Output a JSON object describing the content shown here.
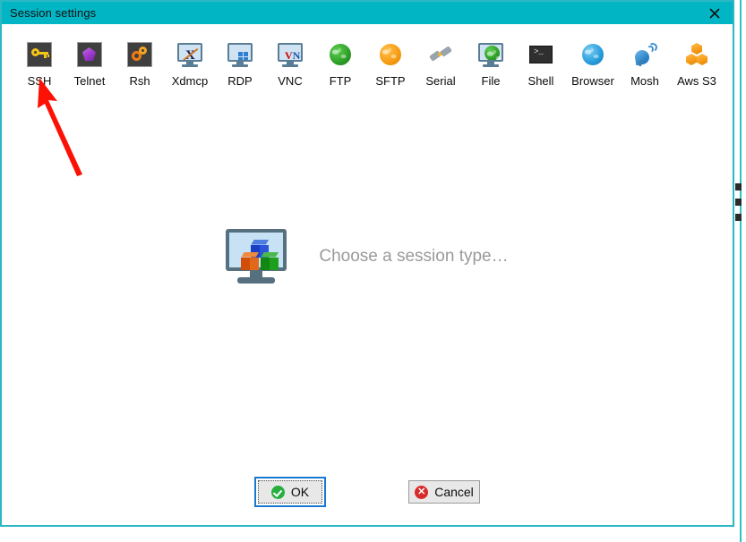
{
  "window": {
    "title": "Session settings",
    "close_icon": "close-icon",
    "title_bar_color": "#01b5c4",
    "border_color": "#2bb7c4"
  },
  "toolbar": {
    "items": [
      {
        "label": "SSH",
        "icon": "key-icon"
      },
      {
        "label": "Telnet",
        "icon": "gem-icon"
      },
      {
        "label": "Rsh",
        "icon": "gears-icon"
      },
      {
        "label": "Xdmcp",
        "icon": "x-monitor-icon"
      },
      {
        "label": "RDP",
        "icon": "windows-monitor-icon"
      },
      {
        "label": "VNC",
        "icon": "vnc-monitor-icon"
      },
      {
        "label": "FTP",
        "icon": "green-globe-icon"
      },
      {
        "label": "SFTP",
        "icon": "orange-globe-icon"
      },
      {
        "label": "Serial",
        "icon": "plug-icon"
      },
      {
        "label": "File",
        "icon": "globe-monitor-icon"
      },
      {
        "label": "Shell",
        "icon": "terminal-icon"
      },
      {
        "label": "Browser",
        "icon": "blue-globe-icon"
      },
      {
        "label": "Mosh",
        "icon": "satellite-dish-icon"
      },
      {
        "label": "Aws S3",
        "icon": "aws-buckets-icon"
      }
    ]
  },
  "main": {
    "placeholder_text": "Choose a session type…",
    "placeholder_icon": "monitor-cubes-icon"
  },
  "footer": {
    "ok_label": "OK",
    "ok_icon": "green-check-icon",
    "cancel_label": "Cancel",
    "cancel_icon": "red-cross-icon",
    "cancel_glyph": "✕"
  },
  "annotation": {
    "arrow": "red-arrow-annotation",
    "arrow_color": "#fc1105"
  },
  "colors": {
    "accent": "#01b5c4",
    "focus_outline": "#1878d2",
    "placeholder_text": "#9a9a9a"
  }
}
